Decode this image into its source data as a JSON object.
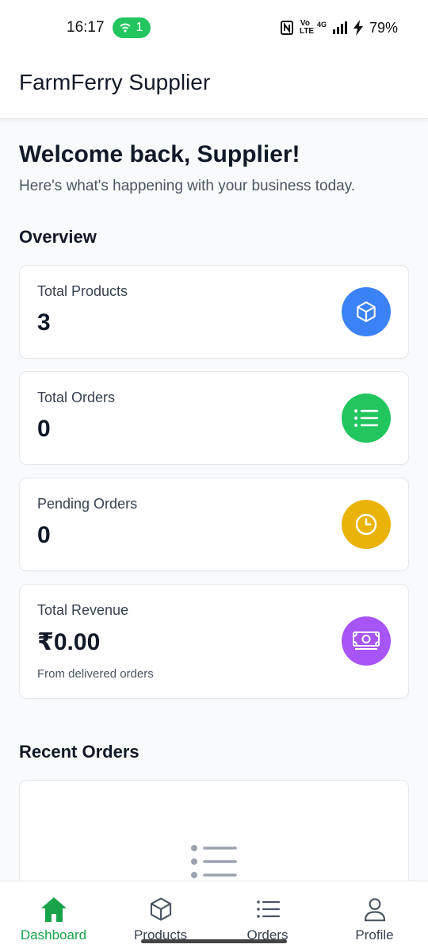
{
  "status_bar": {
    "time": "16:17",
    "hotspot_count": "1",
    "volte": "Vo LTE",
    "network": "4G",
    "battery": "79%"
  },
  "header": {
    "title": "FarmFerry Supplier"
  },
  "welcome": {
    "title": "Welcome back, Supplier!",
    "subtitle": "Here's what's happening with your business today."
  },
  "overview": {
    "title": "Overview",
    "cards": [
      {
        "label": "Total Products",
        "value": "3",
        "icon": "cube-icon",
        "color": "#3b82f6"
      },
      {
        "label": "Total Orders",
        "value": "0",
        "icon": "list-icon",
        "color": "#22c55e"
      },
      {
        "label": "Pending Orders",
        "value": "0",
        "icon": "clock-icon",
        "color": "#eab308"
      },
      {
        "label": "Total Revenue",
        "value": "₹0.00",
        "note": "From delivered orders",
        "icon": "cash-icon",
        "color": "#a855f7"
      }
    ]
  },
  "recent_orders": {
    "title": "Recent Orders",
    "empty_icon": "list-icon"
  },
  "bottom_nav": {
    "items": [
      {
        "label": "Dashboard",
        "icon": "home-icon",
        "active": true
      },
      {
        "label": "Products",
        "icon": "cube-icon"
      },
      {
        "label": "Orders",
        "icon": "list-icon"
      },
      {
        "label": "Profile",
        "icon": "user-icon"
      }
    ],
    "active_color": "#16a34a"
  }
}
